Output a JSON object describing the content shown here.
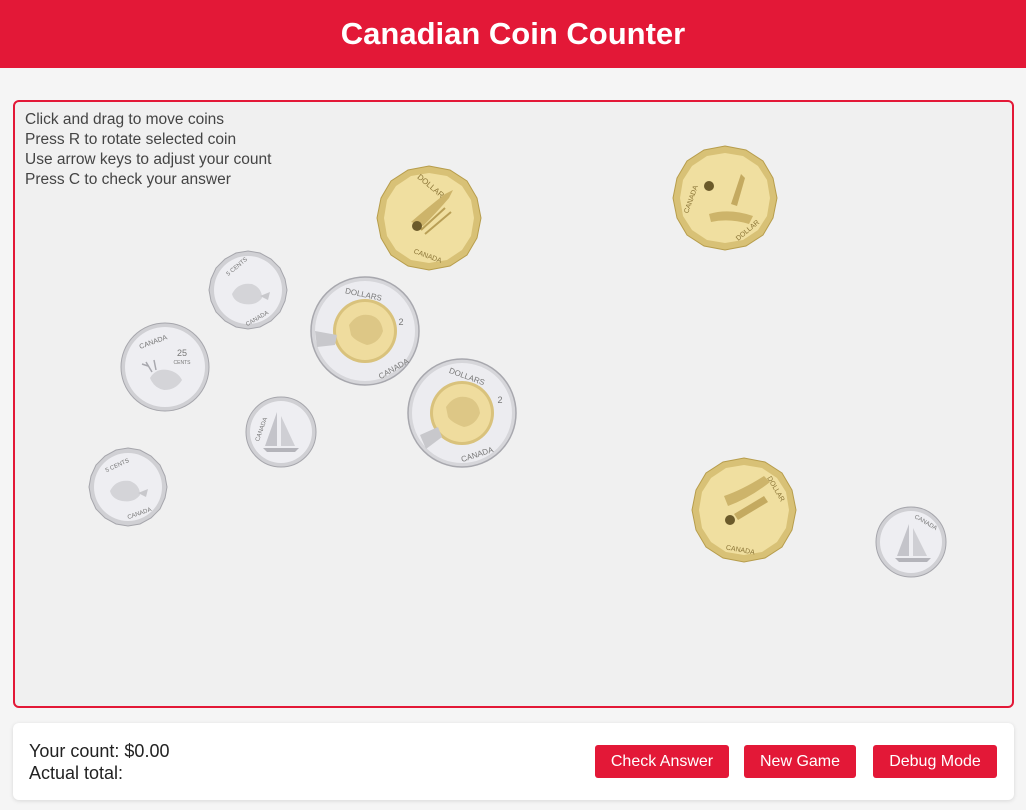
{
  "header": {
    "title": "Canadian Coin Counter"
  },
  "instructions": [
    "Click and drag to move coins",
    "Press R to rotate selected coin",
    "Use arrow keys to adjust your count",
    "Press C to check your answer"
  ],
  "coins": {
    "loonie_label_text": "DOLLAR",
    "canada_text": "CANADA",
    "toonie_label_text": "DOLLARS",
    "toonie_value_text": "2",
    "quarter_value_text": "25",
    "quarter_unit_text": "CENTS",
    "nickel_value_text": "5 CENTS"
  },
  "status": {
    "your_count_label": "Your count:",
    "your_count_value": "$0.00",
    "actual_total_label": "Actual total:",
    "actual_total_value": ""
  },
  "buttons": {
    "check_answer": "Check Answer",
    "new_game": "New Game",
    "debug_mode": "Debug Mode"
  },
  "colors": {
    "brand_red": "#e31837",
    "loonie_gold": "#e8d58e",
    "silver": "#e2e2e6"
  }
}
